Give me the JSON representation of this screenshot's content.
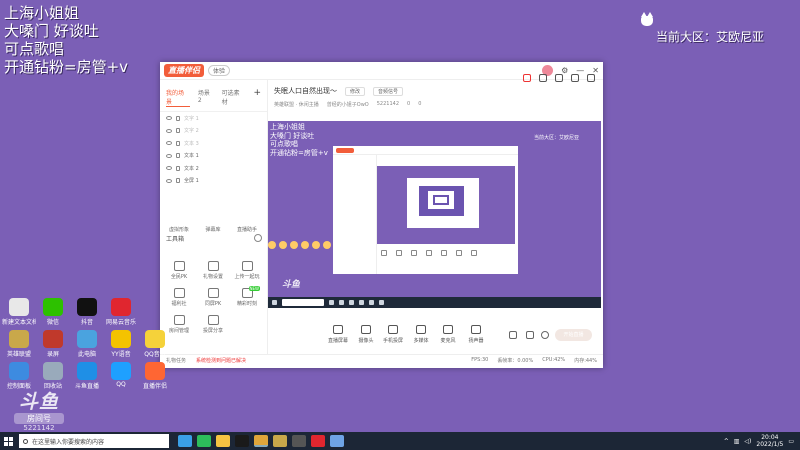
{
  "overlay": {
    "lines": [
      "上海小姐姐",
      "大嗓门 好谈吐",
      "可点歌唱",
      "开通钻粉=房管+v"
    ],
    "region": "当前大区：艾欧尼亚"
  },
  "desktop_icons": [
    {
      "label": "新建文本文档",
      "color": "#e8e8e8"
    },
    {
      "label": "微信",
      "color": "#2dc100"
    },
    {
      "label": "抖音",
      "color": "#111111"
    },
    {
      "label": "网易云音乐",
      "color": "#e0262f"
    },
    {
      "label": "英雄联盟",
      "color": "#c9a84a"
    },
    {
      "label": "录屏",
      "color": "#c0392b"
    },
    {
      "label": "此电脑",
      "color": "#4aa3df"
    },
    {
      "label": "YY语音",
      "color": "#f4c300"
    },
    {
      "label": "QQ音乐",
      "color": "#f5d23a"
    },
    {
      "label": "控制面板",
      "color": "#3d8be0"
    },
    {
      "label": "回收站",
      "color": "#9ab"
    },
    {
      "label": "斗鱼直播",
      "color": "#1f8fe6"
    },
    {
      "label": "QQ",
      "color": "#1ea0ff"
    },
    {
      "label": "直播伴侣",
      "color": "#ff6633"
    }
  ],
  "watermark": {
    "logo": "斗鱼",
    "room_label": "房间号",
    "room_number": "5221142"
  },
  "window": {
    "brand": "直播伴侣",
    "version": "体验",
    "tabs": [
      "我的场景",
      "场景2",
      "可选素材"
    ],
    "sources": [
      "文字 1",
      "文字 2",
      "文本 3",
      "文本 1",
      "文本 2",
      "全屏 1"
    ],
    "room_title": "失眠人口自然出现～",
    "room_tags": [
      "修改",
      "音频信号"
    ],
    "room_meta": [
      "英雄联盟 · 休闲主播",
      "曾经的小姐子OwO",
      "5221142",
      "0",
      "0"
    ],
    "tools_header": "工具箱",
    "tools": [
      "虚拟形象",
      "弹幕库",
      "直播助手",
      "全民PK",
      "礼物设置",
      "上传一起玩",
      "福利社",
      "同屏PK",
      "精彩时刻",
      "房间管理",
      "投屏分享"
    ],
    "controls": [
      "直播屏幕",
      "摄像头",
      "手机投屏",
      "多媒体",
      "麦克风",
      "扬声器"
    ],
    "go_live": "开始直播",
    "status_left": "礼物任务",
    "status_warn": "系统检测到问题已解决",
    "status_right": [
      "FPS:30",
      "丢帧率：0.00%",
      "CPU:42%",
      "内存:44%"
    ]
  },
  "preview": {
    "lines": [
      "上海小姐姐",
      "大嗓门 好谈吐",
      "可点歌唱",
      "开通钻粉=房管+v"
    ],
    "region": "当前大区：艾欧尼亚",
    "logo": "斗鱼"
  },
  "taskbar": {
    "search_placeholder": "在这里输入你要搜索的内容",
    "apps": [
      "#3aa0e6",
      "#2dbd5b",
      "#f6c342",
      "#1a1a1a",
      "#e0a53a",
      "#c9a84a",
      "#555",
      "#e0262f",
      "#6fa4e6"
    ],
    "time": "20:04",
    "date": "2022/1/5"
  }
}
